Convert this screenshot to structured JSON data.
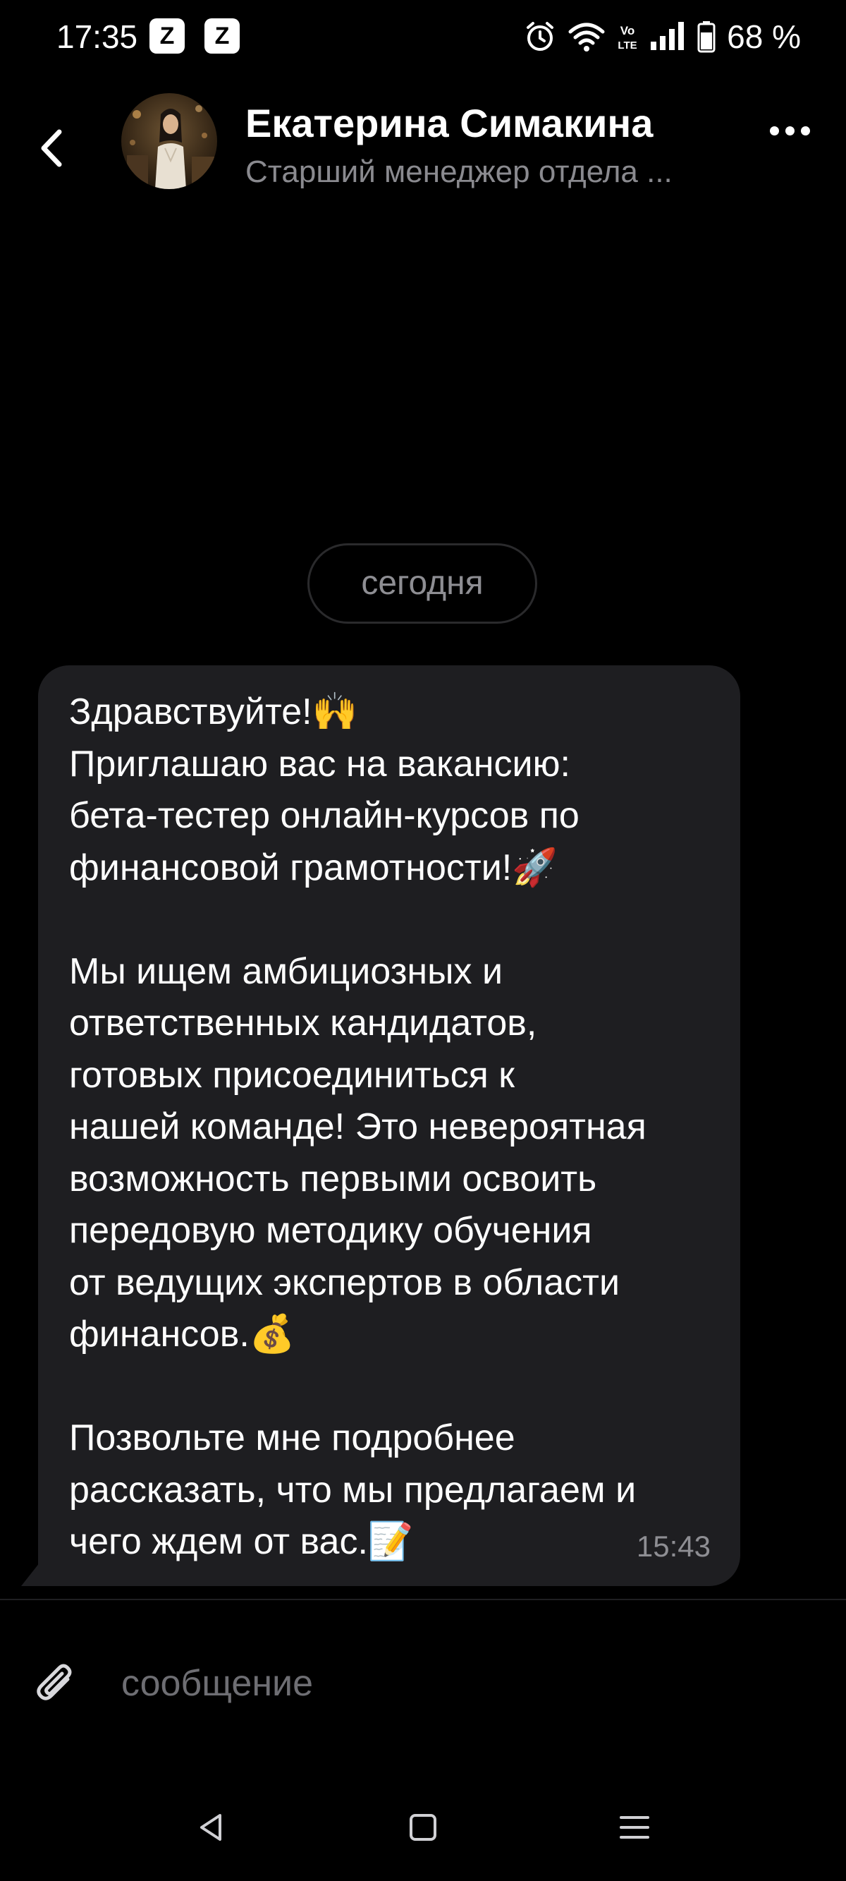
{
  "status_bar": {
    "time": "17:35",
    "notification_icons": [
      "z-app-icon",
      "z-app-icon"
    ],
    "network_label": "Vo LTE",
    "battery_percent": "68 %"
  },
  "header": {
    "contact_name": "Екатерина Симакина",
    "contact_subtitle": "Старший менеджер отдела ..."
  },
  "chat": {
    "date_separator": "сегодня",
    "messages": [
      {
        "text": "Здравствуйте!🙌\nПриглашаю вас на вакансию:\nбета-тестер онлайн-курсов по\nфинансовой грамотности!🚀\n\nМы ищем амбициозных и\nответственных кандидатов,\nготовых присоединиться к\nнашей команде! Это невероятная\nвозможность первыми освоить\nпередовую методику обучения\nот ведущих экспертов в области\nфинансов.💰\n\nПозвольте мне подробнее\nрассказать, что мы предлагаем и\nчего ждем от вас.📝",
        "time": "15:43"
      }
    ]
  },
  "composer": {
    "placeholder": "сообщение"
  },
  "colors": {
    "background": "#000000",
    "bubble": "#1e1e21",
    "secondary_text": "#8e8e93"
  }
}
